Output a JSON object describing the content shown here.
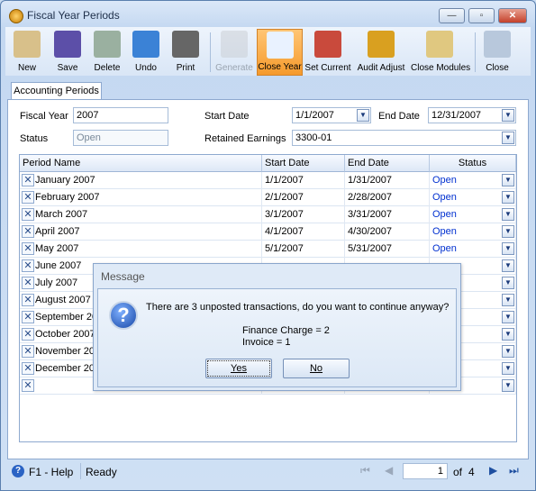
{
  "window": {
    "title": "Fiscal Year Periods"
  },
  "toolbar": [
    {
      "label": "New",
      "icon": "new-document-icon"
    },
    {
      "label": "Save",
      "icon": "floppy-disk-icon"
    },
    {
      "label": "Delete",
      "icon": "recycle-bin-icon"
    },
    {
      "label": "Undo",
      "icon": "undo-arrow-icon"
    },
    {
      "label": "Print",
      "icon": "printer-icon"
    },
    {
      "label": "Generate",
      "icon": "calendar-gear-icon",
      "disabled": true
    },
    {
      "label": "Close Year",
      "icon": "close-year-check-icon",
      "active": true
    },
    {
      "label": "Set Current",
      "icon": "calendar-hand-icon"
    },
    {
      "label": "Audit Adjust",
      "icon": "coins-tools-icon"
    },
    {
      "label": "Close Modules",
      "icon": "clipboard-check-icon"
    },
    {
      "label": "Close",
      "icon": "close-window-icon"
    }
  ],
  "tabs": [
    {
      "label": "Accounting Periods"
    }
  ],
  "form": {
    "fiscal_year_label": "Fiscal Year",
    "fiscal_year": "2007",
    "status_label": "Status",
    "status": "Open",
    "start_date_label": "Start Date",
    "start_date": "1/1/2007",
    "end_date_label": "End Date",
    "end_date": "12/31/2007",
    "retained_earnings_label": "Retained Earnings",
    "retained_earnings": "3300-01"
  },
  "grid": {
    "columns": [
      "Period Name",
      "Start Date",
      "End Date",
      "Status"
    ],
    "rows": [
      {
        "name": "January 2007",
        "start": "1/1/2007",
        "end": "1/31/2007",
        "status": "Open"
      },
      {
        "name": "February 2007",
        "start": "2/1/2007",
        "end": "2/28/2007",
        "status": "Open"
      },
      {
        "name": "March 2007",
        "start": "3/1/2007",
        "end": "3/31/2007",
        "status": "Open"
      },
      {
        "name": "April 2007",
        "start": "4/1/2007",
        "end": "4/30/2007",
        "status": "Open"
      },
      {
        "name": "May 2007",
        "start": "5/1/2007",
        "end": "5/31/2007",
        "status": "Open"
      },
      {
        "name": "June 2007",
        "start": "",
        "end": "",
        "status": ""
      },
      {
        "name": "July 2007",
        "start": "",
        "end": "",
        "status": ""
      },
      {
        "name": "August 2007",
        "start": "",
        "end": "",
        "status": ""
      },
      {
        "name": "September 20",
        "start": "",
        "end": "",
        "status": ""
      },
      {
        "name": "October 2007",
        "start": "",
        "end": "",
        "status": ""
      },
      {
        "name": "November 20",
        "start": "",
        "end": "",
        "status": ""
      },
      {
        "name": "December 20",
        "start": "",
        "end": "",
        "status": ""
      },
      {
        "name": "",
        "start": "",
        "end": "",
        "status": ""
      }
    ]
  },
  "dialog": {
    "title": "Message",
    "message": "There are 3 unposted transactions, do you want to continue anyway?",
    "details": [
      "Finance Charge = 2",
      "Invoice = 1"
    ],
    "yes_label": "Yes",
    "no_label": "No"
  },
  "statusbar": {
    "help": "F1 - Help",
    "status": "Ready",
    "page": "1",
    "of_label": "of",
    "total_pages": "4"
  }
}
